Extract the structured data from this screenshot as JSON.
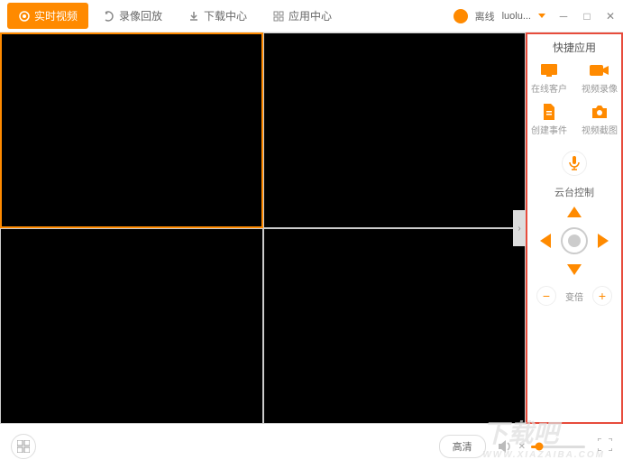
{
  "tabs": {
    "live": "实时视频",
    "playback": "录像回放",
    "download": "下载中心",
    "apps": "应用中心"
  },
  "user": {
    "status": "离线",
    "name": "luolu..."
  },
  "side": {
    "title": "快捷应用",
    "quick": {
      "onlineClient": "在线客户",
      "videoRecord": "视频录像",
      "createEvent": "创建事件",
      "videoCapture": "视频截图"
    },
    "ptzTitle": "云台控制",
    "zoomLabel": "变倍"
  },
  "bottom": {
    "quality": "高清"
  },
  "watermark": {
    "main": "下载吧",
    "sub": "WWW.XIAZAIBA.COM"
  }
}
